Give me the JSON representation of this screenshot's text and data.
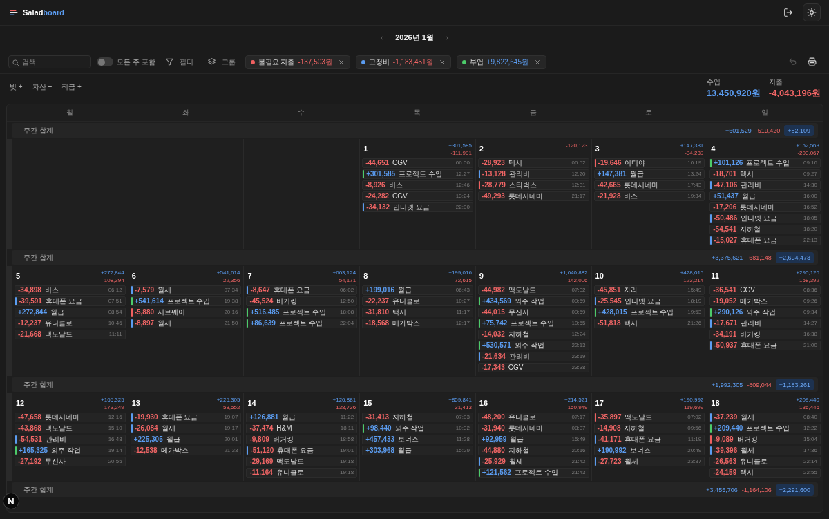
{
  "header": {
    "logo_main": "Salad",
    "logo_accent": "board"
  },
  "month_nav": {
    "title": "2026년 1월"
  },
  "filter_bar": {
    "search": {
      "placeholder": "검색"
    },
    "toggle": {
      "label": "모든 주 포함",
      "on": false
    },
    "filter_label": "필터",
    "group_label": "그룹",
    "chips": [
      {
        "label": "불필요 지출",
        "amount": "-137,503원",
        "kind": "expense",
        "color": "#f06060"
      },
      {
        "label": "고정비",
        "amount": "-1,183,451원",
        "kind": "expense",
        "color": "#5b9cf0"
      },
      {
        "label": "부업",
        "amount": "+9,822,645원",
        "kind": "income",
        "color": "#4ccb6a"
      }
    ],
    "undo_disabled": true
  },
  "asset_buttons": [
    "빚 +",
    "자산 +",
    "적금 +"
  ],
  "totals": {
    "income": {
      "label": "수입",
      "value": "13,450,920원"
    },
    "expense": {
      "label": "지출",
      "value": "-4,043,196원"
    }
  },
  "calendar": {
    "weekdays": [
      "월",
      "화",
      "수",
      "목",
      "금",
      "토",
      "일"
    ],
    "weeks": [
      {
        "summary": {
          "label": "주간 합계",
          "income": "+601,529",
          "expense": "-519,420",
          "net": "+82,109"
        },
        "days": [
          {
            "kind": "blank"
          },
          {
            "kind": "blank"
          },
          {
            "kind": "blank"
          },
          {
            "kind": "day",
            "date": "1",
            "income": "+301,585",
            "expense": "-111,991",
            "entries": [
              {
                "kind": "expense",
                "amount": "-44,651",
                "label": "CGV",
                "time": "06:00"
              },
              {
                "kind": "income",
                "amount": "+301,585",
                "label": "프로젝트 수입",
                "time": "12:27",
                "color": "#4ccb6a"
              },
              {
                "kind": "expense",
                "amount": "-8,926",
                "label": "버스",
                "time": "12:46"
              },
              {
                "kind": "expense",
                "amount": "-24,282",
                "label": "CGV",
                "time": "13:24"
              },
              {
                "kind": "expense",
                "amount": "-34,132",
                "label": "인터넷 요금",
                "time": "22:00",
                "color": "#5b9cf0"
              }
            ]
          },
          {
            "kind": "day",
            "date": "2",
            "expense": "-120,123",
            "entries": [
              {
                "kind": "expense",
                "amount": "-28,923",
                "label": "택시",
                "time": "06:52"
              },
              {
                "kind": "expense",
                "amount": "-13,128",
                "label": "관리비",
                "time": "12:20",
                "color": "#5b9cf0"
              },
              {
                "kind": "expense",
                "amount": "-28,779",
                "label": "스타벅스",
                "time": "12:31",
                "color": "#f06060"
              },
              {
                "kind": "expense",
                "amount": "-49,293",
                "label": "롯데시네마",
                "time": "21:17"
              }
            ]
          },
          {
            "kind": "day",
            "date": "3",
            "income": "+147,381",
            "expense": "-84,239",
            "entries": [
              {
                "kind": "expense",
                "amount": "-19,646",
                "label": "이디야",
                "time": "10:19",
                "color": "#f06060"
              },
              {
                "kind": "income",
                "amount": "+147,381",
                "label": "월급",
                "time": "13:24"
              },
              {
                "kind": "expense",
                "amount": "-42,665",
                "label": "롯데시네마",
                "time": "17:43"
              },
              {
                "kind": "expense",
                "amount": "-21,928",
                "label": "버스",
                "time": "19:34"
              }
            ]
          },
          {
            "kind": "day",
            "date": "4",
            "income": "+152,563",
            "expense": "-203,067",
            "entries": [
              {
                "kind": "income",
                "amount": "+101,126",
                "label": "프로젝트 수입",
                "time": "09:16",
                "color": "#4ccb6a"
              },
              {
                "kind": "expense",
                "amount": "-18,701",
                "label": "택시",
                "time": "09:27"
              },
              {
                "kind": "expense",
                "amount": "-47,106",
                "label": "관리비",
                "time": "14:30",
                "color": "#5b9cf0"
              },
              {
                "kind": "income",
                "amount": "+51,437",
                "label": "월급",
                "time": "16:00"
              },
              {
                "kind": "expense",
                "amount": "-17,206",
                "label": "롯데시네마",
                "time": "16:52"
              },
              {
                "kind": "expense",
                "amount": "-50,486",
                "label": "인터넷 요금",
                "time": "18:05",
                "color": "#5b9cf0"
              },
              {
                "kind": "expense",
                "amount": "-54,541",
                "label": "지하철",
                "time": "18:20"
              },
              {
                "kind": "expense",
                "amount": "-15,027",
                "label": "휴대폰 요금",
                "time": "22:13",
                "color": "#5b9cf0"
              }
            ]
          }
        ]
      },
      {
        "summary": {
          "label": "주간 합계",
          "income": "+3,375,621",
          "expense": "-681,148",
          "net": "+2,694,473"
        },
        "days": [
          {
            "kind": "day",
            "date": "5",
            "income": "+272,844",
            "expense": "-108,394",
            "entries": [
              {
                "kind": "expense",
                "amount": "-34,898",
                "label": "버스",
                "time": "06:12"
              },
              {
                "kind": "expense",
                "amount": "-39,591",
                "label": "휴대폰 요금",
                "time": "07:51",
                "color": "#5b9cf0"
              },
              {
                "kind": "income",
                "amount": "+272,844",
                "label": "월급",
                "time": "08:54"
              },
              {
                "kind": "expense",
                "amount": "-12,237",
                "label": "유니클로",
                "time": "10:46"
              },
              {
                "kind": "expense",
                "amount": "-21,668",
                "label": "맥도날드",
                "time": "11:11"
              }
            ]
          },
          {
            "kind": "day",
            "date": "6",
            "income": "+541,614",
            "expense": "-22,356",
            "entries": [
              {
                "kind": "expense",
                "amount": "-7,579",
                "label": "월세",
                "time": "07:34",
                "color": "#5b9cf0"
              },
              {
                "kind": "income",
                "amount": "+541,614",
                "label": "프로젝트 수입",
                "time": "19:38",
                "color": "#4ccb6a"
              },
              {
                "kind": "expense",
                "amount": "-5,880",
                "label": "서브웨이",
                "time": "20:16",
                "color": "#f06060"
              },
              {
                "kind": "expense",
                "amount": "-8,897",
                "label": "월세",
                "time": "21:50",
                "color": "#5b9cf0"
              }
            ]
          },
          {
            "kind": "day",
            "date": "7",
            "income": "+603,124",
            "expense": "-54,171",
            "entries": [
              {
                "kind": "expense",
                "amount": "-8,647",
                "label": "휴대폰 요금",
                "time": "06:02",
                "color": "#5b9cf0"
              },
              {
                "kind": "expense",
                "amount": "-45,524",
                "label": "버거킹",
                "time": "12:50"
              },
              {
                "kind": "income",
                "amount": "+516,485",
                "label": "프로젝트 수입",
                "time": "18:08",
                "color": "#4ccb6a"
              },
              {
                "kind": "income",
                "amount": "+86,639",
                "label": "프로젝트 수입",
                "time": "22:04",
                "color": "#4ccb6a"
              }
            ]
          },
          {
            "kind": "day",
            "date": "8",
            "income": "+199,016",
            "expense": "-72,615",
            "entries": [
              {
                "kind": "income",
                "amount": "+199,016",
                "label": "월급",
                "time": "06:43"
              },
              {
                "kind": "expense",
                "amount": "-22,237",
                "label": "유니클로",
                "time": "10:27"
              },
              {
                "kind": "expense",
                "amount": "-31,810",
                "label": "택시",
                "time": "11:17"
              },
              {
                "kind": "expense",
                "amount": "-18,568",
                "label": "메가박스",
                "time": "12:17"
              }
            ]
          },
          {
            "kind": "day",
            "date": "9",
            "income": "+1,040,882",
            "expense": "-142,006",
            "entries": [
              {
                "kind": "expense",
                "amount": "-44,982",
                "label": "맥도날드",
                "time": "07:02"
              },
              {
                "kind": "income",
                "amount": "+434,569",
                "label": "외주 작업",
                "time": "09:59",
                "color": "#4ccb6a"
              },
              {
                "kind": "expense",
                "amount": "-44,015",
                "label": "무신사",
                "time": "09:59"
              },
              {
                "kind": "income",
                "amount": "+75,742",
                "label": "프로젝트 수입",
                "time": "10:55",
                "color": "#4ccb6a"
              },
              {
                "kind": "expense",
                "amount": "-14,032",
                "label": "지하철",
                "time": "12:24"
              },
              {
                "kind": "income",
                "amount": "+530,571",
                "label": "외주 작업",
                "time": "22:13",
                "color": "#4ccb6a"
              },
              {
                "kind": "expense",
                "amount": "-21,634",
                "label": "관리비",
                "time": "23:19",
                "color": "#5b9cf0"
              },
              {
                "kind": "expense",
                "amount": "-17,343",
                "label": "CGV",
                "time": "23:38"
              }
            ]
          },
          {
            "kind": "day",
            "date": "10",
            "income": "+428,015",
            "expense": "-123,214",
            "entries": [
              {
                "kind": "expense",
                "amount": "-45,851",
                "label": "자라",
                "time": "15:49"
              },
              {
                "kind": "expense",
                "amount": "-25,545",
                "label": "인터넷 요금",
                "time": "18:19",
                "color": "#5b9cf0"
              },
              {
                "kind": "income",
                "amount": "+428,015",
                "label": "프로젝트 수입",
                "time": "19:53",
                "color": "#4ccb6a"
              },
              {
                "kind": "expense",
                "amount": "-51,818",
                "label": "택시",
                "time": "21:26"
              }
            ]
          },
          {
            "kind": "day",
            "date": "11",
            "income": "+290,126",
            "expense": "-158,392",
            "entries": [
              {
                "kind": "expense",
                "amount": "-36,541",
                "label": "CGV",
                "time": "08:36"
              },
              {
                "kind": "expense",
                "amount": "-19,052",
                "label": "메가박스",
                "time": "09:26"
              },
              {
                "kind": "income",
                "amount": "+290,126",
                "label": "외주 작업",
                "time": "09:34",
                "color": "#4ccb6a"
              },
              {
                "kind": "expense",
                "amount": "-17,671",
                "label": "관리비",
                "time": "14:27",
                "color": "#5b9cf0"
              },
              {
                "kind": "expense",
                "amount": "-34,191",
                "label": "버거킹",
                "time": "16:38"
              },
              {
                "kind": "expense",
                "amount": "-50,937",
                "label": "휴대폰 요금",
                "time": "21:00",
                "color": "#5b9cf0"
              }
            ]
          }
        ]
      },
      {
        "summary": {
          "label": "주간 합계",
          "income": "+1,992,305",
          "expense": "-809,044",
          "net": "+1,183,261"
        },
        "days": [
          {
            "kind": "day",
            "date": "12",
            "income": "+165,325",
            "expense": "-173,249",
            "entries": [
              {
                "kind": "expense",
                "amount": "-47,658",
                "label": "롯데시네마",
                "time": "12:16"
              },
              {
                "kind": "expense",
                "amount": "-43,868",
                "label": "맥도날드",
                "time": "15:10"
              },
              {
                "kind": "expense",
                "amount": "-54,531",
                "label": "관리비",
                "time": "16:48",
                "color": "#5b9cf0"
              },
              {
                "kind": "income",
                "amount": "+165,325",
                "label": "외주 작업",
                "time": "19:14",
                "color": "#4ccb6a"
              },
              {
                "kind": "expense",
                "amount": "-27,192",
                "label": "무신사",
                "time": "20:55"
              }
            ]
          },
          {
            "kind": "day",
            "date": "13",
            "income": "+225,305",
            "expense": "-58,552",
            "entries": [
              {
                "kind": "expense",
                "amount": "-19,930",
                "label": "휴대폰 요금",
                "time": "19:07",
                "color": "#5b9cf0"
              },
              {
                "kind": "expense",
                "amount": "-26,084",
                "label": "월세",
                "time": "19:17",
                "color": "#5b9cf0"
              },
              {
                "kind": "income",
                "amount": "+225,305",
                "label": "월급",
                "time": "20:01"
              },
              {
                "kind": "expense",
                "amount": "-12,538",
                "label": "메가박스",
                "time": "21:33"
              }
            ]
          },
          {
            "kind": "day",
            "date": "14",
            "income": "+126,881",
            "expense": "-138,736",
            "entries": [
              {
                "kind": "income",
                "amount": "+126,881",
                "label": "월급",
                "time": "11:22"
              },
              {
                "kind": "expense",
                "amount": "-37,474",
                "label": "H&M",
                "time": "18:11"
              },
              {
                "kind": "expense",
                "amount": "-9,809",
                "label": "버거킹",
                "time": "18:58"
              },
              {
                "kind": "expense",
                "amount": "-51,120",
                "label": "휴대폰 요금",
                "time": "19:01",
                "color": "#5b9cf0"
              },
              {
                "kind": "expense",
                "amount": "-29,169",
                "label": "맥도날드",
                "time": "19:18"
              },
              {
                "kind": "expense",
                "amount": "-11,164",
                "label": "유니클로",
                "time": "19:18"
              }
            ]
          },
          {
            "kind": "day",
            "date": "15",
            "income": "+859,841",
            "expense": "-31,413",
            "entries": [
              {
                "kind": "expense",
                "amount": "-31,413",
                "label": "지하철",
                "time": "07:03"
              },
              {
                "kind": "income",
                "amount": "+98,440",
                "label": "외주 작업",
                "time": "10:32",
                "color": "#4ccb6a"
              },
              {
                "kind": "income",
                "amount": "+457,433",
                "label": "보너스",
                "time": "11:28"
              },
              {
                "kind": "income",
                "amount": "+303,968",
                "label": "월급",
                "time": "15:29"
              }
            ]
          },
          {
            "kind": "day",
            "date": "16",
            "income": "+214,521",
            "expense": "-150,949",
            "entries": [
              {
                "kind": "expense",
                "amount": "-48,200",
                "label": "유니클로",
                "time": "07:17"
              },
              {
                "kind": "expense",
                "amount": "-31,940",
                "label": "롯데시네마",
                "time": "08:37"
              },
              {
                "kind": "income",
                "amount": "+92,959",
                "label": "월급",
                "time": "15:49"
              },
              {
                "kind": "expense",
                "amount": "-44,880",
                "label": "지하철",
                "time": "20:16"
              },
              {
                "kind": "expense",
                "amount": "-25,929",
                "label": "월세",
                "time": "21:42",
                "color": "#5b9cf0"
              },
              {
                "kind": "income",
                "amount": "+121,562",
                "label": "프로젝트 수입",
                "time": "21:43",
                "color": "#4ccb6a"
              }
            ]
          },
          {
            "kind": "day",
            "date": "17",
            "income": "+190,992",
            "expense": "-119,699",
            "entries": [
              {
                "kind": "expense",
                "amount": "-35,897",
                "label": "맥도날드",
                "time": "07:02",
                "color": "#f06060"
              },
              {
                "kind": "expense",
                "amount": "-14,908",
                "label": "지하철",
                "time": "09:56"
              },
              {
                "kind": "expense",
                "amount": "-41,171",
                "label": "휴대폰 요금",
                "time": "11:19",
                "color": "#5b9cf0"
              },
              {
                "kind": "income",
                "amount": "+190,992",
                "label": "보너스",
                "time": "20:49"
              },
              {
                "kind": "expense",
                "amount": "-27,723",
                "label": "월세",
                "time": "23:37",
                "color": "#5b9cf0"
              }
            ]
          },
          {
            "kind": "day",
            "date": "18",
            "income": "+209,440",
            "expense": "-136,446",
            "entries": [
              {
                "kind": "expense",
                "amount": "-37,239",
                "label": "월세",
                "time": "08:40",
                "color": "#5b9cf0"
              },
              {
                "kind": "income",
                "amount": "+209,440",
                "label": "프로젝트 수입",
                "time": "12:22",
                "color": "#4ccb6a"
              },
              {
                "kind": "expense",
                "amount": "-9,089",
                "label": "버거킹",
                "time": "15:04",
                "color": "#f06060"
              },
              {
                "kind": "expense",
                "amount": "-39,396",
                "label": "월세",
                "time": "17:36",
                "color": "#5b9cf0"
              },
              {
                "kind": "expense",
                "amount": "-26,563",
                "label": "유니클로",
                "time": "22:14"
              },
              {
                "kind": "expense",
                "amount": "-24,159",
                "label": "택시",
                "time": "22:55"
              }
            ]
          }
        ]
      },
      {
        "summary": {
          "label": "주간 합계",
          "income": "+3,455,706",
          "expense": "-1,164,106",
          "net": "+2,291,600"
        }
      }
    ]
  },
  "dev_badge": {
    "text": "N"
  }
}
